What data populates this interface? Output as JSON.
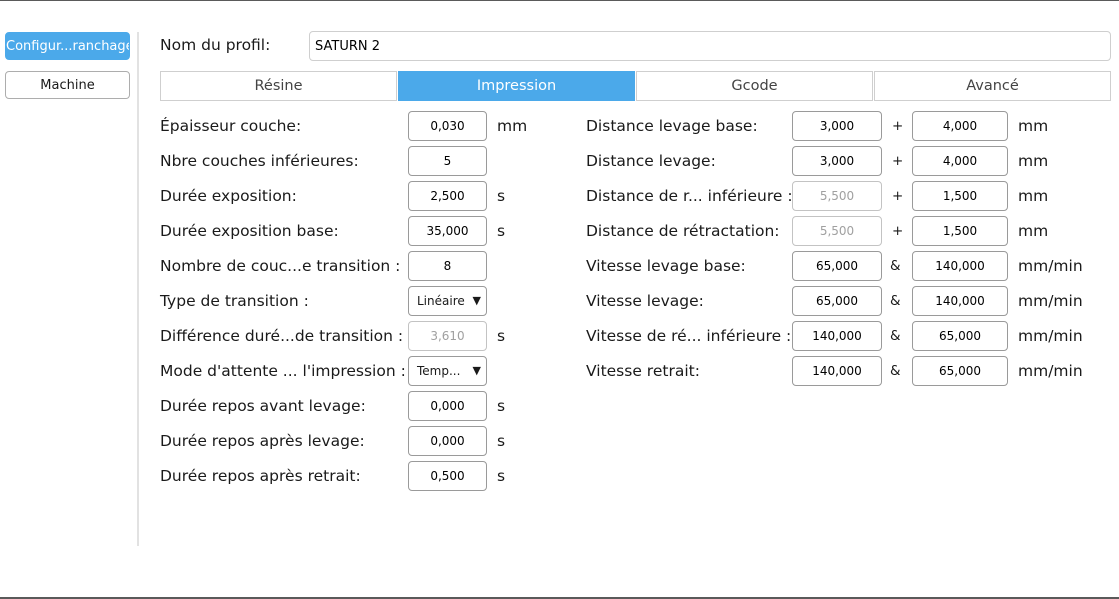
{
  "sidebar": {
    "items": [
      {
        "label": "Configur...ranchage"
      },
      {
        "label": "Machine"
      }
    ]
  },
  "profile": {
    "label": "Nom du profil:",
    "value": "SATURN 2"
  },
  "tabs": [
    {
      "label": "Résine"
    },
    {
      "label": "Impression"
    },
    {
      "label": "Gcode"
    },
    {
      "label": "Avancé"
    }
  ],
  "left": {
    "rows": [
      {
        "label": "Épaisseur couche:",
        "value": "0,030",
        "unit": "mm"
      },
      {
        "label": "Nbre couches inférieures:",
        "value": "5",
        "unit": ""
      },
      {
        "label": "Durée exposition:",
        "value": "2,500",
        "unit": "s"
      },
      {
        "label": "Durée exposition base:",
        "value": "35,000",
        "unit": "s"
      },
      {
        "label": "Nombre de couc...e transition :",
        "value": "8",
        "unit": ""
      },
      {
        "label": "Type de transition :",
        "value": "Linéaire",
        "unit": ""
      },
      {
        "label": "Différence duré...de transition :",
        "value": "3,610",
        "unit": "s"
      },
      {
        "label": "Mode d'attente ... l'impression :",
        "value": "Temp...",
        "unit": ""
      },
      {
        "label": "Durée repos avant levage:",
        "value": "0,000",
        "unit": "s"
      },
      {
        "label": "Durée repos après levage:",
        "value": "0,000",
        "unit": "s"
      },
      {
        "label": "Durée repos après retrait:",
        "value": "0,500",
        "unit": "s"
      }
    ]
  },
  "right": {
    "rows": [
      {
        "label": "Distance levage base:",
        "v1": "3,000",
        "sep": "+",
        "v2": "4,000",
        "unit": "mm"
      },
      {
        "label": "Distance levage:",
        "v1": "3,000",
        "sep": "+",
        "v2": "4,000",
        "unit": "mm"
      },
      {
        "label": "Distance de r... inférieure :",
        "v1": "5,500",
        "sep": "+",
        "v2": "1,500",
        "unit": "mm"
      },
      {
        "label": "Distance de rétractation:",
        "v1": "5,500",
        "sep": "+",
        "v2": "1,500",
        "unit": "mm"
      },
      {
        "label": "Vitesse levage base:",
        "v1": "65,000",
        "sep": "&",
        "v2": "140,000",
        "unit": "mm/min"
      },
      {
        "label": "Vitesse levage:",
        "v1": "65,000",
        "sep": "&",
        "v2": "140,000",
        "unit": "mm/min"
      },
      {
        "label": "Vitesse de ré... inférieure :",
        "v1": "140,000",
        "sep": "&",
        "v2": "65,000",
        "unit": "mm/min"
      },
      {
        "label": "Vitesse retrait:",
        "v1": "140,000",
        "sep": "&",
        "v2": "65,000",
        "unit": "mm/min"
      }
    ]
  },
  "icons": {
    "dropdown": "triangle-down-icon"
  },
  "colors": {
    "accent": "#4ba9ea"
  }
}
